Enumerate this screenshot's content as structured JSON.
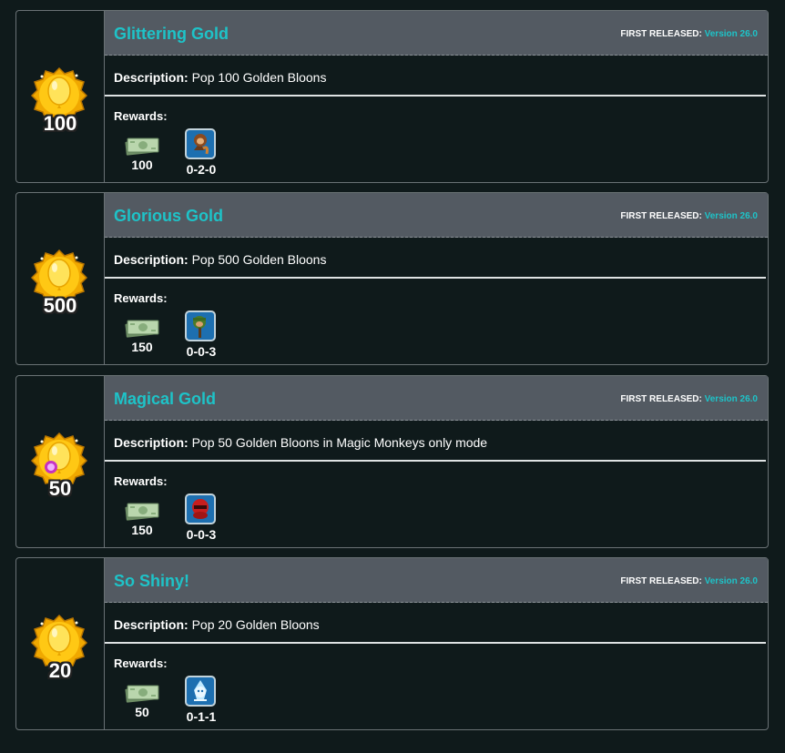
{
  "cards": [
    {
      "medal_number": "100",
      "title": "Glittering Gold",
      "released_label": "FIRST RELEASED:",
      "released_version": "Version 26.0",
      "description_label": "Description:",
      "description": "Pop 100 Golden Bloons",
      "rewards_label": "Rewards:",
      "cash": "100",
      "tower_path": "0-2-0",
      "tower_icon": "boomerang-monkey-icon",
      "medal_icon": "golden-bloon-medal-icon"
    },
    {
      "medal_number": "500",
      "title": "Glorious Gold",
      "released_label": "FIRST RELEASED:",
      "released_version": "Version 26.0",
      "description_label": "Description:",
      "description": "Pop 500 Golden Bloons",
      "rewards_label": "Rewards:",
      "cash": "150",
      "tower_path": "0-0-3",
      "tower_icon": "sniper-monkey-icon",
      "medal_icon": "golden-bloon-medal-icon"
    },
    {
      "medal_number": "50",
      "title": "Magical Gold",
      "released_label": "FIRST RELEASED:",
      "released_version": "Version 26.0",
      "description_label": "Description:",
      "description": "Pop 50 Golden Bloons in Magic Monkeys only mode",
      "rewards_label": "Rewards:",
      "cash": "150",
      "tower_path": "0-0-3",
      "tower_icon": "ninja-monkey-icon",
      "medal_icon": "magic-golden-bloon-medal-icon"
    },
    {
      "medal_number": "20",
      "title": "So Shiny!",
      "released_label": "FIRST RELEASED:",
      "released_version": "Version 26.0",
      "description_label": "Description:",
      "description": "Pop 20 Golden Bloons",
      "rewards_label": "Rewards:",
      "cash": "50",
      "tower_path": "0-1-1",
      "tower_icon": "ice-monkey-icon",
      "medal_icon": "golden-bloon-medal-icon"
    }
  ],
  "colors": {
    "background": "#0f1a1b",
    "header": "#535a62",
    "accent": "#1ec3c8",
    "gold": "#f5b800",
    "cash": "#a9c9a0"
  }
}
